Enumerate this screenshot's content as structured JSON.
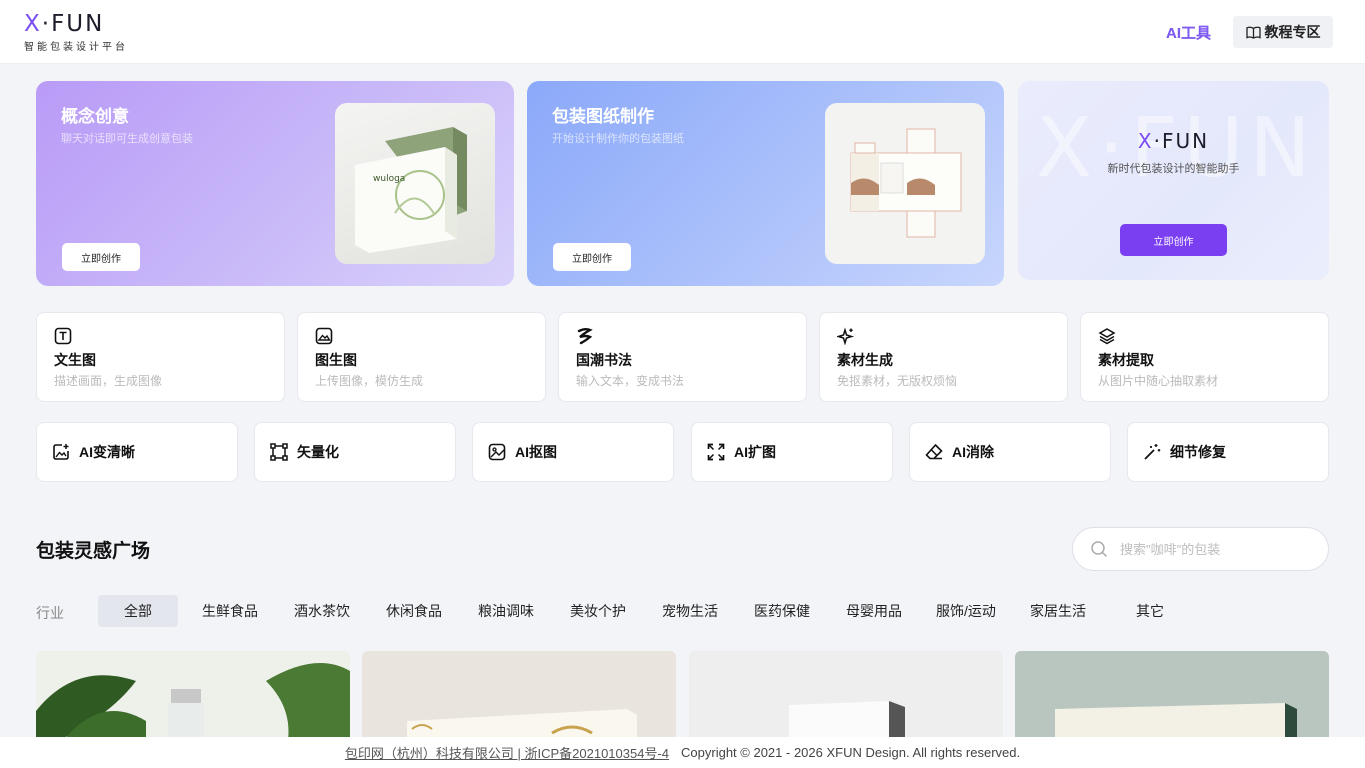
{
  "header": {
    "logo_text": "X·FUN",
    "logo_subtitle": "智能包装设计平台",
    "ai_tools": "AI工具",
    "tutorial": "教程专区"
  },
  "heroes": [
    {
      "title": "概念创意",
      "subtitle": "聊天对话即可生成创意包装",
      "button": "立即创作"
    },
    {
      "title": "包装图纸制作",
      "subtitle": "开始设计制作你的包装图纸",
      "button": "立即创作"
    },
    {
      "logo": "X·FUN",
      "subtitle": "新时代包装设计的智能助手",
      "button": "立即创作",
      "watermark": "X·FUN"
    }
  ],
  "tools": [
    {
      "title": "文生图",
      "desc": "描述画面，生成图像",
      "icon": "text-t-icon"
    },
    {
      "title": "图生图",
      "desc": "上传图像，模仿生成",
      "icon": "image-icon"
    },
    {
      "title": "国潮书法",
      "desc": "输入文本，变成书法",
      "icon": "calligraphy-icon"
    },
    {
      "title": "素材生成",
      "desc": "免抠素材，无版权烦恼",
      "icon": "sparkles-icon"
    },
    {
      "title": "素材提取",
      "desc": "从图片中随心抽取素材",
      "icon": "layers-icon"
    }
  ],
  "quick_tools": [
    {
      "label": "AI变清晰",
      "icon": "image-plus-icon"
    },
    {
      "label": "矢量化",
      "icon": "vector-icon"
    },
    {
      "label": "AI抠图",
      "icon": "image-cutout-icon"
    },
    {
      "label": "AI扩图",
      "icon": "expand-icon"
    },
    {
      "label": "AI消除",
      "icon": "eraser-icon"
    },
    {
      "label": "细节修复",
      "icon": "magic-wand-icon"
    }
  ],
  "gallery_section": {
    "title": "包装灵感广场",
    "search_placeholder": "搜索\"咖啡\"的包装",
    "industry_label": "行业",
    "categories": [
      "全部",
      "生鲜食品",
      "酒水茶饮",
      "休闲食品",
      "粮油调味",
      "美妆个护",
      "宠物生活",
      "医药保健",
      "母婴用品",
      "服饰/运动",
      "家居生活",
      "其它"
    ],
    "active_category": "全部"
  },
  "footer": {
    "company_link": "包印网（杭州）科技有限公司 | 浙ICP备2021010354号-4",
    "copyright": "Copyright © 2021 - 2026 XFUN Design. All rights reserved."
  },
  "colors": {
    "accent": "#7b3ff2",
    "hero1_gradient_start": "#b99bf7",
    "hero2_gradient_start": "#8ba9fa",
    "background": "#f2f4f8"
  }
}
